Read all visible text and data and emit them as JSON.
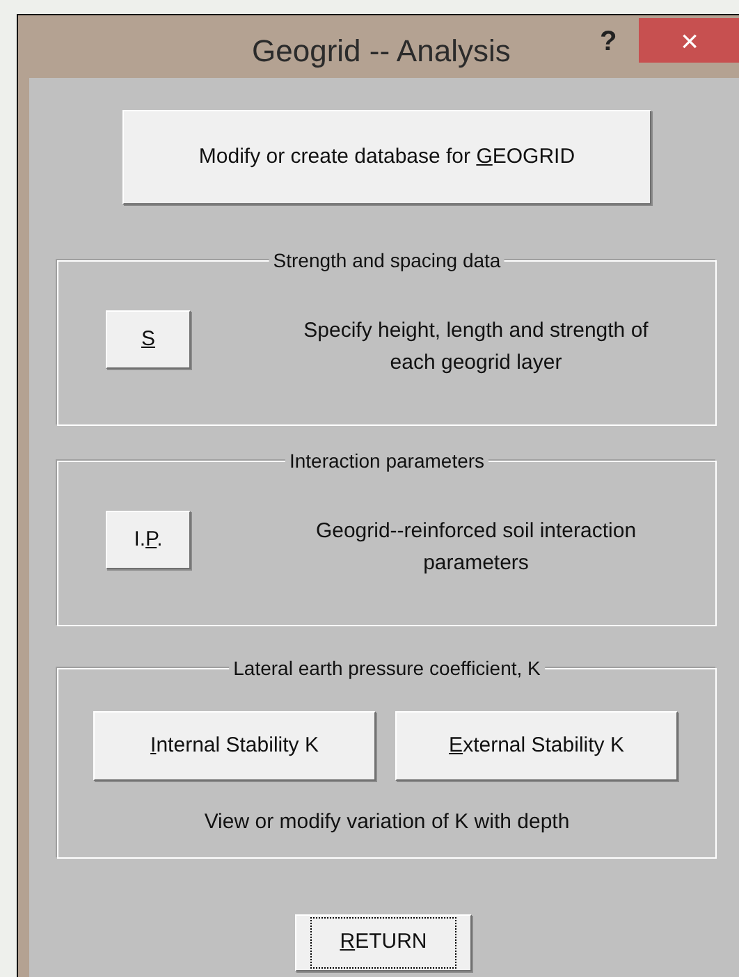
{
  "window": {
    "title": "Geogrid -- Analysis",
    "help": "?",
    "close": "×"
  },
  "database_button": {
    "label": {
      "before": "Modify or create database for ",
      "key": "G",
      "after": "EOGRID"
    }
  },
  "groups": [
    {
      "kind": "single",
      "title": "Strength and spacing data",
      "buttons": [
        {
          "label": {
            "key": "S"
          }
        }
      ],
      "description": "Specify height, length and  strength of each geogrid layer"
    },
    {
      "kind": "single",
      "title": "Interaction parameters",
      "buttons": [
        {
          "label": {
            "before": "I.",
            "key": "P",
            "after": "."
          }
        }
      ],
      "description": "Geogrid--reinforced soil interaction parameters"
    },
    {
      "kind": "pair",
      "title": "Lateral earth pressure coefficient, K",
      "buttons": [
        {
          "label": {
            "key": "I",
            "after": "nternal Stability K"
          }
        },
        {
          "label": {
            "key": "E",
            "after": "xternal Stability K"
          }
        }
      ],
      "description": "View or modify variation of K with depth"
    }
  ],
  "return_button": {
    "label": {
      "key": "R",
      "after": "ETURN"
    },
    "focused": true
  }
}
